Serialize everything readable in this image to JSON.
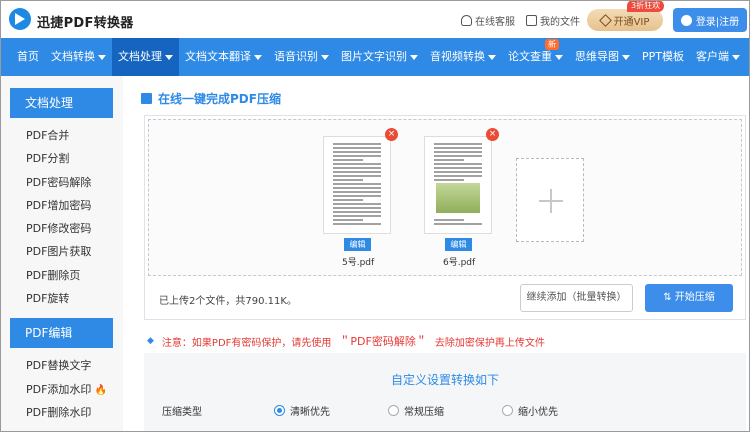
{
  "header": {
    "brand": "迅捷PDF转换器",
    "service": "在线客服",
    "my_files": "我的文件",
    "vip_label": "开通VIP",
    "vip_badge": "3折狂欢",
    "login": "登录|注册"
  },
  "nav": {
    "items": [
      {
        "label": "首页",
        "caret": false
      },
      {
        "label": "文档转换",
        "caret": true
      },
      {
        "label": "文档处理",
        "caret": true,
        "active": true
      },
      {
        "label": "文档文本翻译",
        "caret": true
      },
      {
        "label": "语音识别",
        "caret": true
      },
      {
        "label": "图片文字识别",
        "caret": true
      },
      {
        "label": "音视频转换",
        "caret": true
      },
      {
        "label": "论文查重",
        "caret": true
      },
      {
        "label": "思维导图",
        "caret": true
      },
      {
        "label": "PPT模板",
        "caret": false
      },
      {
        "label": "客户端",
        "caret": true
      }
    ],
    "new_badge": "新"
  },
  "sidebar": {
    "section1": "文档处理",
    "items1": [
      "PDF合并",
      "PDF分割",
      "PDF密码解除",
      "PDF增加密码",
      "PDF修改密码",
      "PDF图片获取",
      "PDF删除页",
      "PDF旋转"
    ],
    "section2": "PDF编辑",
    "items2": [
      "PDF替换文字",
      "PDF添加水印",
      "PDF删除水印"
    ]
  },
  "main": {
    "title": "在线一键完成PDF压缩",
    "files": [
      {
        "name": "5号.pdf",
        "edit": "编辑"
      },
      {
        "name": "6号.pdf",
        "edit": "编辑"
      }
    ],
    "remove_icon": "×",
    "uploaded": "已上传2个文件，共790.11K。",
    "more_button": "继续添加（批量转换）",
    "start_button": "开始压缩",
    "notice_prefix": "注意：如果PDF有密码保护，请先使用",
    "notice_link": "＂PDF密码解除＂",
    "notice_suffix": "去除加密保护再上传文件",
    "settings_title": "自定义设置转换如下",
    "compress_label": "压缩类型",
    "options": [
      "清晰优先",
      "常规压缩",
      "缩小优先"
    ],
    "selected_option": "清晰优先"
  },
  "colors": {
    "accent": "#2f8ae6",
    "active_nav": "#1565c0",
    "warning": "#e53935",
    "vip": "#e7c18e"
  }
}
